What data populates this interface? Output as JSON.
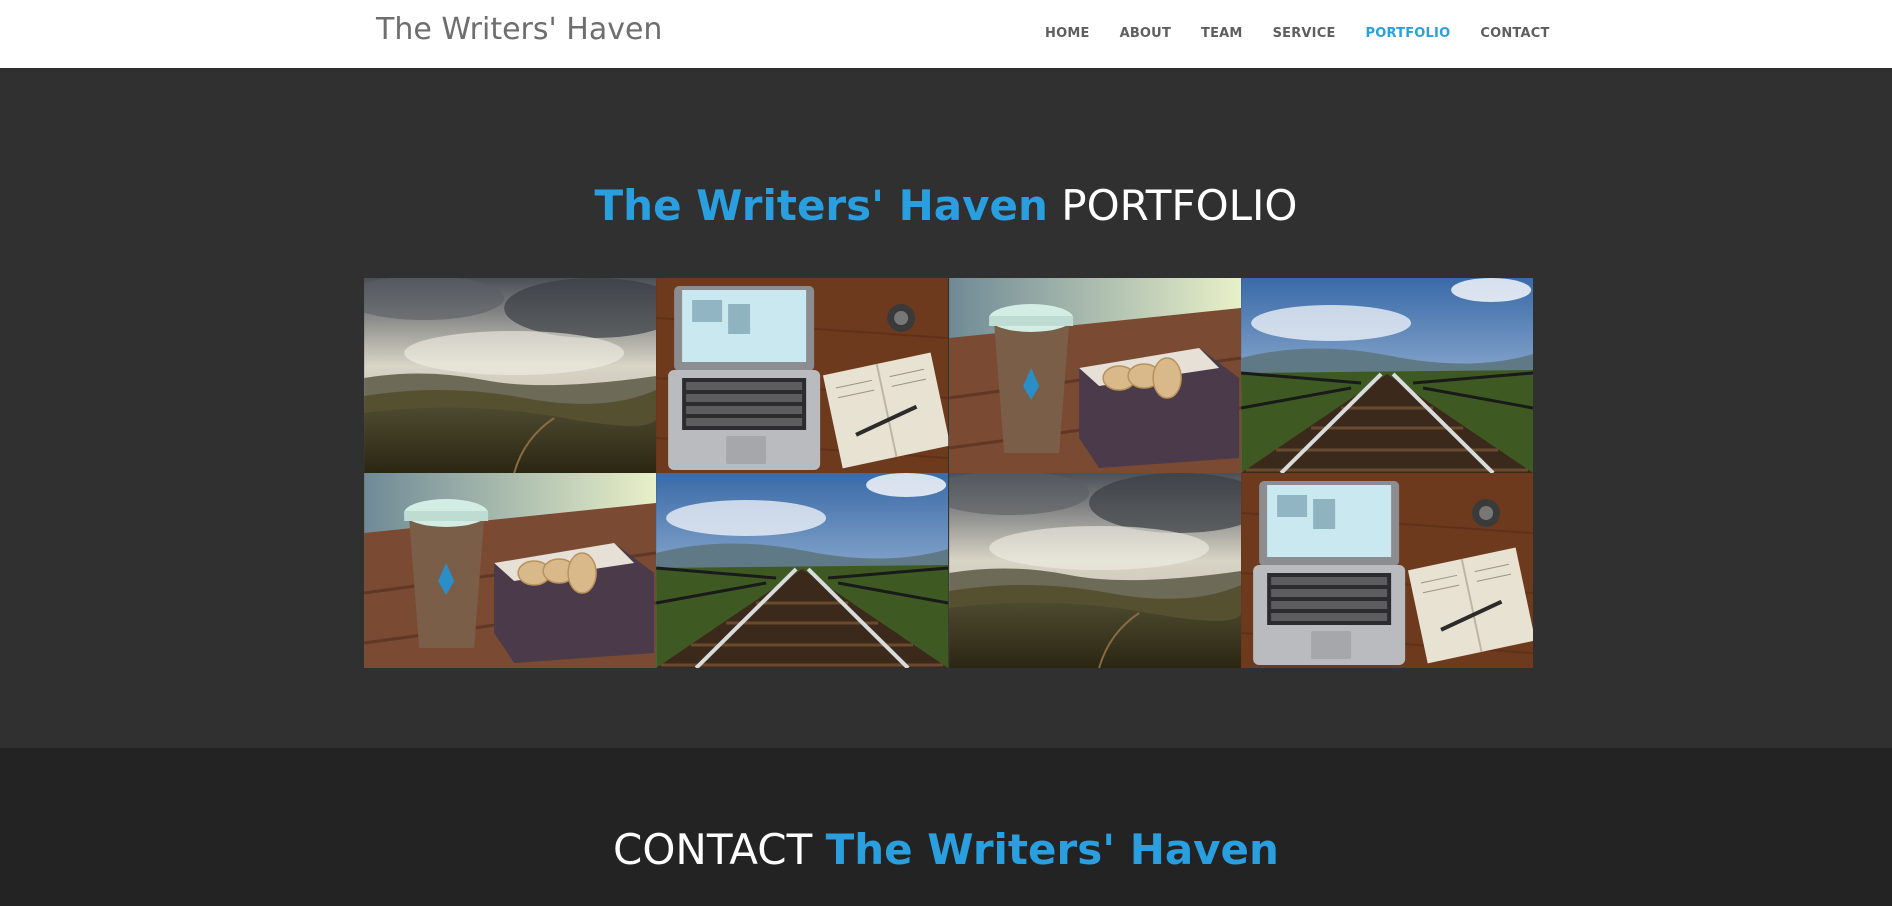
{
  "nav": {
    "brand": "The Writers' Haven",
    "items": [
      {
        "label": "HOME"
      },
      {
        "label": "ABOUT"
      },
      {
        "label": "TEAM"
      },
      {
        "label": "SERVICE"
      },
      {
        "label": "PORTFOLIO",
        "active": true
      },
      {
        "label": "CONTACT"
      }
    ]
  },
  "portfolio": {
    "title_accent": "The Writers' Haven",
    "title_plain": "PORTFOLIO",
    "tiles": [
      {
        "image": "landscape-hills"
      },
      {
        "image": "laptop-notebook-desk"
      },
      {
        "image": "coffee-cup-cookies"
      },
      {
        "image": "railway-bridge"
      },
      {
        "image": "coffee-cup-cookies"
      },
      {
        "image": "railway-bridge"
      },
      {
        "image": "landscape-hills"
      },
      {
        "image": "laptop-notebook-desk"
      }
    ]
  },
  "contact": {
    "title_plain": "CONTACT",
    "title_accent": "The Writers' Haven"
  },
  "colors": {
    "accent": "#2a9fe0",
    "portfolio_bg": "#303030",
    "contact_bg": "#232323"
  }
}
